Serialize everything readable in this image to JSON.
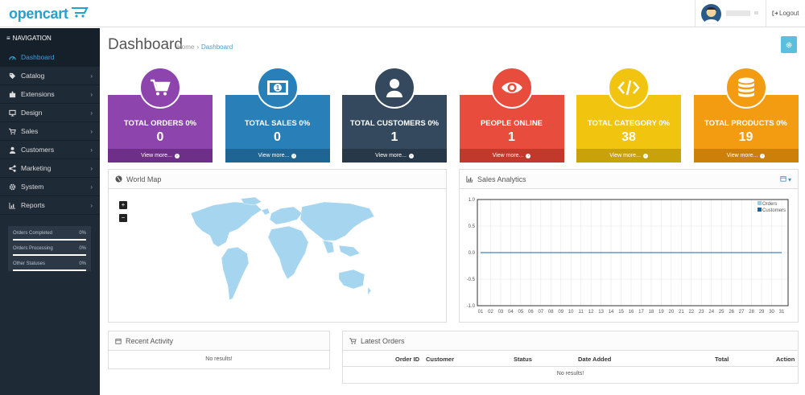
{
  "header": {
    "logo_text": "opencart",
    "logout_label": "Logout"
  },
  "sidebar": {
    "nav_title": "NAVIGATION",
    "items": [
      {
        "label": "Dashboard",
        "icon": "dashboard-icon",
        "active": true
      },
      {
        "label": "Catalog",
        "icon": "tag-icon"
      },
      {
        "label": "Extensions",
        "icon": "puzzle-icon"
      },
      {
        "label": "Design",
        "icon": "monitor-icon"
      },
      {
        "label": "Sales",
        "icon": "cart-icon"
      },
      {
        "label": "Customers",
        "icon": "user-icon"
      },
      {
        "label": "Marketing",
        "icon": "share-icon"
      },
      {
        "label": "System",
        "icon": "gear-icon"
      },
      {
        "label": "Reports",
        "icon": "bar-chart-icon"
      }
    ],
    "progress": [
      {
        "label": "Orders Completed",
        "percent": "0%"
      },
      {
        "label": "Orders Processing",
        "percent": "0%"
      },
      {
        "label": "Other Statuses",
        "percent": "0%"
      }
    ]
  },
  "page": {
    "title": "Dashboard",
    "breadcrumb": [
      "Home",
      "Dashboard"
    ],
    "breadcrumb_sep": "›"
  },
  "tiles": [
    {
      "title": "TOTAL ORDERS 0%",
      "value": "0",
      "link": "View more...",
      "color": "#8e44ad",
      "dark": "#6d2f87",
      "icon": "cart-icon"
    },
    {
      "title": "TOTAL SALES 0%",
      "value": "0",
      "link": "View more...",
      "color": "#2980b9",
      "dark": "#1f6593",
      "icon": "money-icon"
    },
    {
      "title": "TOTAL CUSTOMERS 0%",
      "value": "1",
      "link": "View more...",
      "color": "#34495e",
      "dark": "#273849",
      "icon": "user-icon"
    },
    {
      "title": "PEOPLE ONLINE",
      "value": "1",
      "link": "View more...",
      "color": "#e74c3c",
      "dark": "#c0392b",
      "icon": "eye-icon"
    },
    {
      "title": "TOTAL CATEGORY 0%",
      "value": "38",
      "link": "View more...",
      "color": "#f1c40f",
      "dark": "#c9a20a",
      "icon": "code-icon"
    },
    {
      "title": "TOTAL PRODUCTS 0%",
      "value": "19",
      "link": "View more...",
      "color": "#f39c12",
      "dark": "#cc800a",
      "icon": "database-icon"
    }
  ],
  "world_map": {
    "title": "World Map",
    "zoom_in": "+",
    "zoom_out": "−"
  },
  "sales_analytics": {
    "title": "Sales Analytics"
  },
  "chart_data": {
    "type": "line",
    "x": [
      "01",
      "02",
      "03",
      "04",
      "05",
      "06",
      "07",
      "08",
      "09",
      "10",
      "11",
      "12",
      "13",
      "14",
      "15",
      "16",
      "17",
      "18",
      "19",
      "20",
      "21",
      "22",
      "23",
      "24",
      "25",
      "26",
      "27",
      "28",
      "29",
      "30",
      "31"
    ],
    "series": [
      {
        "name": "Orders",
        "values": [
          0,
          0,
          0,
          0,
          0,
          0,
          0,
          0,
          0,
          0,
          0,
          0,
          0,
          0,
          0,
          0,
          0,
          0,
          0,
          0,
          0,
          0,
          0,
          0,
          0,
          0,
          0,
          0,
          0,
          0,
          0
        ],
        "color": "#9acde8"
      },
      {
        "name": "Customers",
        "values": [
          0,
          0,
          0,
          0,
          0,
          0,
          0,
          0,
          0,
          0,
          0,
          0,
          0,
          0,
          0,
          0,
          0,
          0,
          0,
          0,
          0,
          0,
          0,
          0,
          0,
          0,
          0,
          0,
          0,
          0,
          0
        ],
        "color": "#1065a8"
      }
    ],
    "yticks": [
      "1.0",
      "0.5",
      "0.0",
      "-0.5",
      "-1.0"
    ],
    "ylim": [
      -1.0,
      1.0
    ],
    "grid": true,
    "legend": "top-right"
  },
  "recent_activity": {
    "title": "Recent Activity",
    "empty": "No results!"
  },
  "latest_orders": {
    "title": "Latest Orders",
    "columns": [
      "Order ID",
      "Customer",
      "Status",
      "Date Added",
      "Total",
      "Action"
    ],
    "empty": "No results!"
  }
}
